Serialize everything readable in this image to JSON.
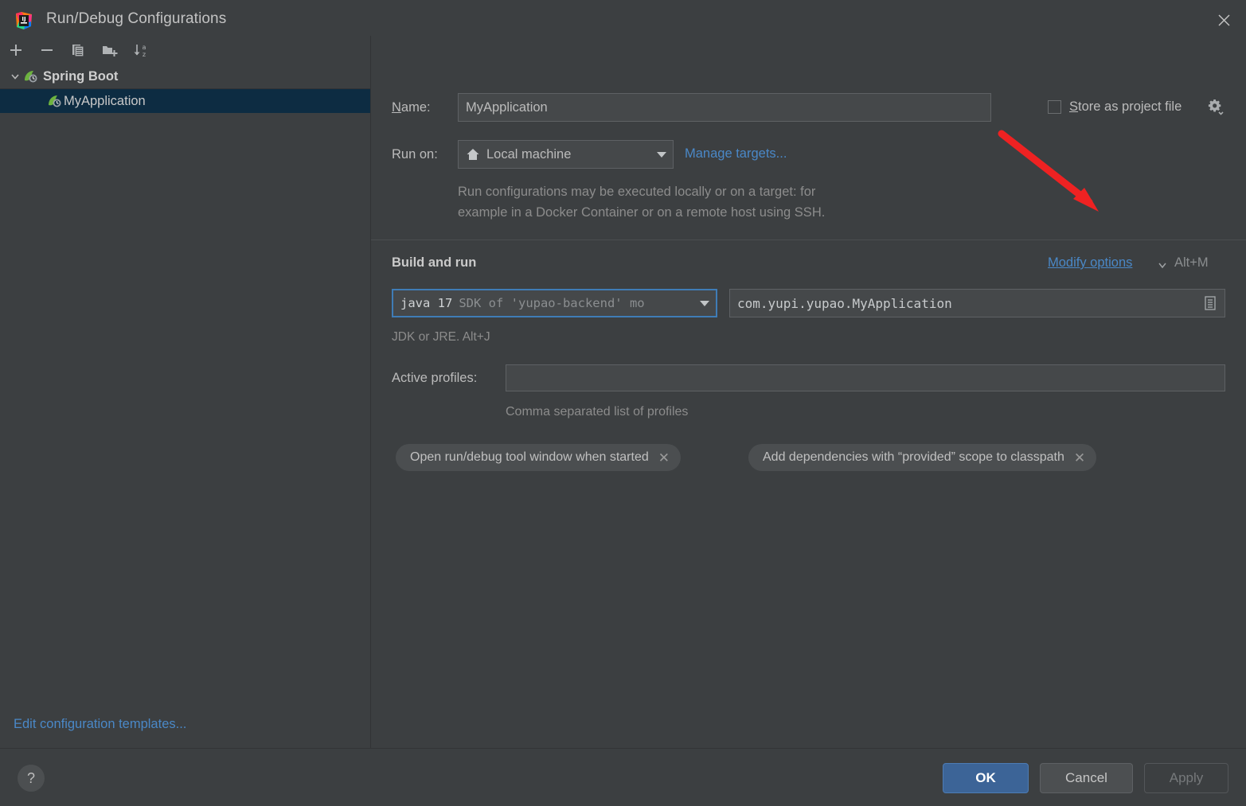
{
  "window": {
    "title": "Run/Debug Configurations",
    "app_icon": "intellij-idea-logo-icon",
    "close_icon": "close-icon",
    "background_sliver_text": "··· ··· ··  ···· ···· ···   ·· ·· ···"
  },
  "sidebar": {
    "toolbar": [
      {
        "name": "add-configuration-button",
        "icon": "plus-icon",
        "label": "Add New Configuration"
      },
      {
        "name": "remove-configuration-button",
        "icon": "minus-icon",
        "label": "Remove Configuration"
      },
      {
        "name": "copy-configuration-button",
        "icon": "copy-icon",
        "label": "Copy Configuration"
      },
      {
        "name": "new-folder-button",
        "icon": "new-folder-icon",
        "label": "Create New Folder"
      },
      {
        "name": "sort-configurations-button",
        "icon": "sort-alpha-icon",
        "label": "Sort Configurations"
      }
    ],
    "tree": [
      {
        "label": "Spring Boot",
        "icon": "spring-boot-icon",
        "expanded": true,
        "selected": false,
        "chevron": "chevron-down-icon"
      },
      {
        "label": "MyApplication",
        "icon": "spring-boot-icon",
        "expanded": false,
        "selected": true,
        "chevron": ""
      }
    ],
    "edit_templates_link": "Edit configuration templates..."
  },
  "form": {
    "name_label": "Name:",
    "name_label_mnemonic": "N",
    "name_label_rest": "ame:",
    "name_value": "MyApplication",
    "store_as_project_file": {
      "label": "Store as project file",
      "label_mnemonic": "S",
      "label_rest": "tore as project file",
      "checked": false,
      "gear_icon": "gear-dropdown-icon"
    },
    "run_on_label": "Run on:",
    "run_on_value": "Local machine",
    "run_on_icon": "home-icon",
    "manage_targets_link": "Manage targets...",
    "run_on_description_line1": "Run configurations may be executed locally or on a target: for",
    "run_on_description_line2": "example in a Docker Container or on a remote host using SSH.",
    "build_and_run_title": "Build and run",
    "modify_options_link": "Modify options",
    "modify_options_chevron": "chevron-down-icon",
    "modify_options_shortcut": "Alt+M",
    "jdk_value_primary": "java 17",
    "jdk_value_secondary": "SDK of 'yupao-backend' mo",
    "jdk_hint": "JDK or JRE. Alt+J",
    "main_class_value": "com.yupi.yupao.MyApplication",
    "main_class_browse_icon": "class-browse-icon",
    "active_profiles_label": "Active profiles:",
    "active_profiles_value": "",
    "active_profiles_hint": "Comma separated list of profiles",
    "option_chips": [
      {
        "label": "Open run/debug tool window when started",
        "close_icon": "chip-close-icon"
      },
      {
        "label": "Add dependencies with “provided” scope to classpath",
        "close_icon": "chip-close-icon"
      }
    ]
  },
  "footer": {
    "help_icon": "help-question-icon",
    "ok_label": "OK",
    "cancel_label": "Cancel",
    "apply_label": "Apply"
  },
  "annotation": {
    "arrow_color": "#EE2222",
    "points_to": "modify-options-link"
  },
  "colors": {
    "dialog_background": "#3C3F41",
    "field_background": "#45484A",
    "selection_background": "#0D2C42",
    "link": "#4A88C7",
    "accent_primary_button": "#3C6497",
    "spring_green": "#6DB33F"
  }
}
